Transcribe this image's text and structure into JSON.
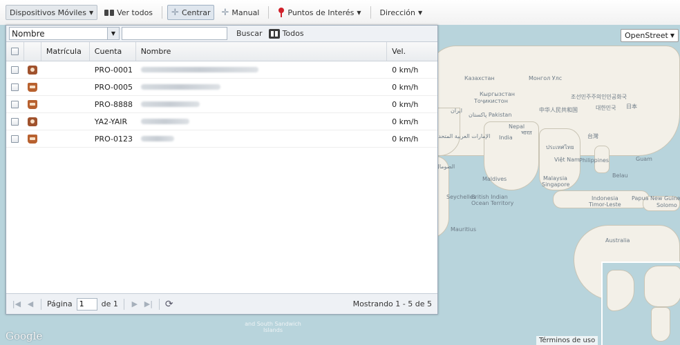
{
  "toolbar": {
    "devices_label": "Dispositivos Móviles",
    "view_all_label": "Ver todos",
    "center_label": "Centrar",
    "manual_label": "Manual",
    "poi_label": "Puntos de Interés",
    "address_label": "Dirección"
  },
  "search": {
    "field_selected": "Nombre",
    "query": "",
    "search_label": "Buscar",
    "all_label": "Todos"
  },
  "grid": {
    "columns": {
      "plate": "Matrícula",
      "account": "Cuenta",
      "name": "Nombre",
      "speed": "Vel."
    },
    "rows": [
      {
        "plate": "",
        "account": "PRO-0001",
        "speed": "0 km/h",
        "icon": "vehicle-alt-icon"
      },
      {
        "plate": "",
        "account": "PRO-0005",
        "speed": "0 km/h",
        "icon": "vehicle-icon"
      },
      {
        "plate": "",
        "account": "PRO-8888",
        "speed": "0 km/h",
        "icon": "vehicle-icon"
      },
      {
        "plate": "",
        "account": "YA2-YAIR",
        "speed": "0 km/h",
        "icon": "vehicle-alt-icon"
      },
      {
        "plate": "",
        "account": "PRO-0123",
        "speed": "0 km/h",
        "icon": "vehicle-icon"
      }
    ]
  },
  "pager": {
    "page_label": "Página",
    "page_value": "1",
    "of_label": "de 1",
    "status": "Mostrando 1 - 5 de 5"
  },
  "map": {
    "type_selected": "OpenStreet",
    "attribution": "Términos de uso",
    "labels": {
      "kazakhstan": "Казахстан",
      "mongolia": "Монгол Улс",
      "kyrgyzstan": "Кыргызстан",
      "tajikistan": "Тоҷикистон",
      "korea_n": "조선민주주의인민공화국",
      "korea_s": "대한민국",
      "japan": "日本",
      "china": "中华人民共和国",
      "pakistan": "پاکستان Pakistan",
      "iran": "ایران",
      "nepal": "Nepal",
      "india": "India",
      "bhutan": "भारत",
      "taiwan": "台灣",
      "thailand": "ประเทศไทย",
      "vietnam": "Việt Nam",
      "philippines": "Philippines",
      "guam": "Guam",
      "uae": "الإمارات العربية المتحدة",
      "somalia": "الصومال",
      "maldives": "Maldives",
      "malaysia": "Malaysia",
      "singapore": "Singapore",
      "belau": "Belau",
      "seychelles": "Seychelles",
      "biot": "British Indian Ocean Territory",
      "indonesia": "Indonesia",
      "png": "Papua New Guinea",
      "timor": "Timor-Leste",
      "solomon": "Solomo",
      "mauritius": "Mauritius",
      "australia": "Australia",
      "south_georgia": "and South Sandwich Islands"
    }
  }
}
